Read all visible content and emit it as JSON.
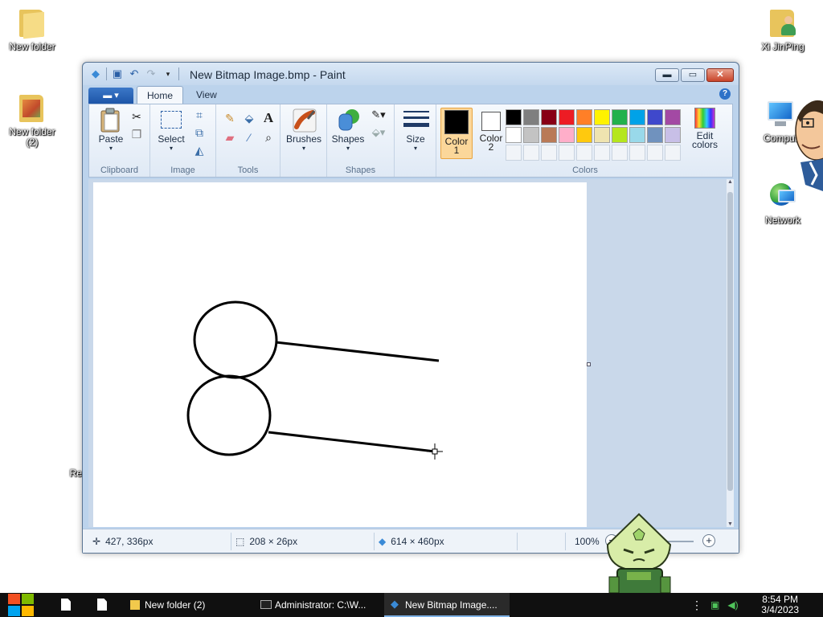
{
  "desktop": {
    "icons": [
      {
        "label": "New folder"
      },
      {
        "label": "New folder\n(2)"
      },
      {
        "label": "Xi JinPing"
      },
      {
        "label": "Compute"
      },
      {
        "label": "Network"
      },
      {
        "label": "Re"
      }
    ]
  },
  "window": {
    "title": "New Bitmap Image.bmp - Paint",
    "tabs": [
      "Home",
      "View"
    ],
    "ribbon": {
      "clipboard": {
        "paste_label": "Paste",
        "group_label": "Clipboard"
      },
      "image": {
        "select_label": "Select",
        "group_label": "Image"
      },
      "tools": {
        "group_label": "Tools"
      },
      "brushes_label": "Brushes",
      "shapes": {
        "shapes_label": "Shapes",
        "group_label": "Shapes"
      },
      "size_label": "Size",
      "colors": {
        "color1_label": "Color",
        "color1_num": "1",
        "color2_label": "Color",
        "color2_num": "2",
        "edit_label": "Edit",
        "edit_label2": "colors",
        "group_label": "Colors",
        "color1": "#000000",
        "color2": "#ffffff",
        "palette_row1": [
          "#000000",
          "#7f7f7f",
          "#880015",
          "#ed1c24",
          "#ff7f27",
          "#fff200",
          "#22b14c",
          "#00a2e8",
          "#3f48cc",
          "#a349a4"
        ],
        "palette_row2": [
          "#ffffff",
          "#c3c3c3",
          "#b97a57",
          "#ffaec9",
          "#ffc90e",
          "#efe4b0",
          "#b5e61d",
          "#99d9ea",
          "#7092be",
          "#c8bfe7"
        ]
      }
    },
    "status": {
      "cursor_pos": "427, 336px",
      "selection_size": "208 × 26px",
      "image_size": "614 × 460px",
      "zoom": "100%"
    }
  },
  "taskbar": {
    "tasks": [
      "New folder (2)",
      "Administrator: C:\\W...",
      "New Bitmap Image...."
    ],
    "time": "8:54 PM",
    "date": "3/4/2023"
  }
}
